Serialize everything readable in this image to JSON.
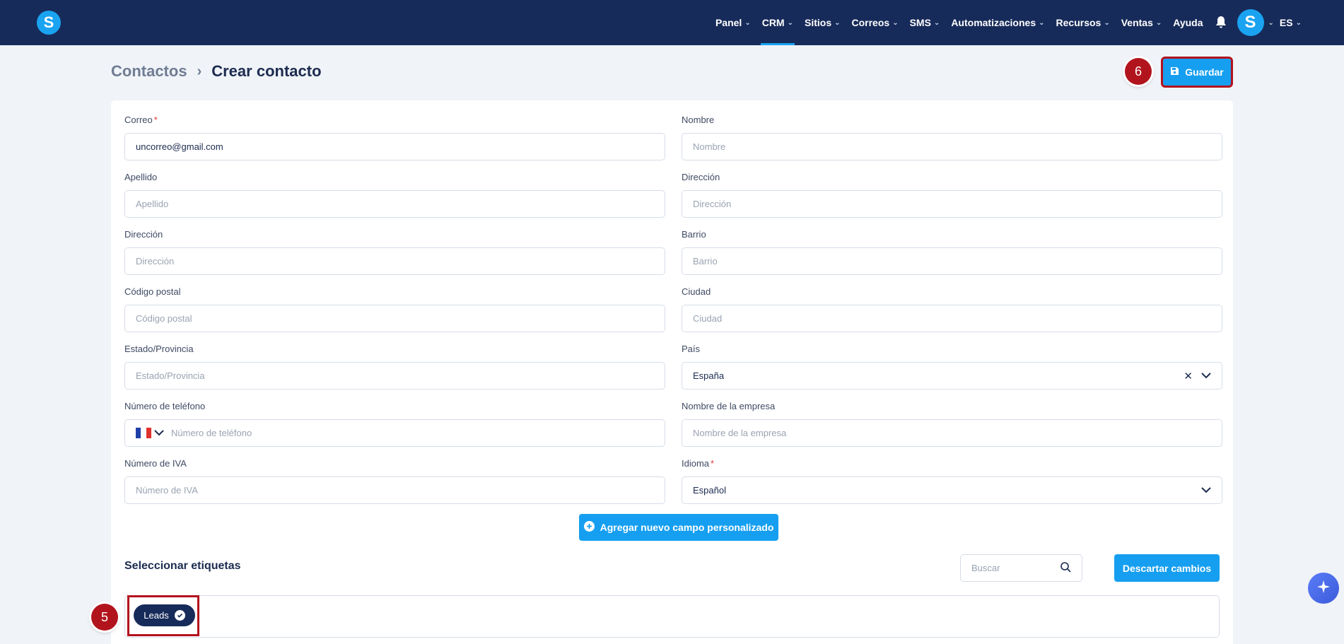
{
  "nav": {
    "items": [
      {
        "label": "Panel",
        "chevron": true,
        "active": false
      },
      {
        "label": "CRM",
        "chevron": true,
        "active": true
      },
      {
        "label": "Sitios",
        "chevron": true,
        "active": false
      },
      {
        "label": "Correos",
        "chevron": true,
        "active": false
      },
      {
        "label": "SMS",
        "chevron": true,
        "active": false
      },
      {
        "label": "Automatizaciones",
        "chevron": true,
        "active": false
      },
      {
        "label": "Recursos",
        "chevron": true,
        "active": false
      },
      {
        "label": "Ventas",
        "chevron": true,
        "active": false
      },
      {
        "label": "Ayuda",
        "chevron": false,
        "active": false
      }
    ],
    "logo_letter": "S",
    "avatar_letter": "S",
    "language": "ES",
    "icons": {
      "notifications": "bell-icon",
      "logo": "logo-icon"
    }
  },
  "breadcrumb": {
    "parent": "Contactos",
    "current": "Crear contacto"
  },
  "save_button": {
    "label": "Guardar",
    "icon": "floppy-disk-icon"
  },
  "badges": {
    "save": "6",
    "tag": "5"
  },
  "form": {
    "left": [
      {
        "label": "Correo",
        "required": true,
        "value": "uncorreo@gmail.com",
        "placeholder": ""
      },
      {
        "label": "Apellido",
        "required": false,
        "value": "",
        "placeholder": "Apellido"
      },
      {
        "label": "Dirección",
        "required": false,
        "value": "",
        "placeholder": "Dirección"
      },
      {
        "label": "Código postal",
        "required": false,
        "value": "",
        "placeholder": "Código postal"
      },
      {
        "label": "Estado/Provincia",
        "required": false,
        "value": "",
        "placeholder": "Estado/Provincia"
      },
      {
        "label": "Número de teléfono",
        "required": false,
        "value": "",
        "placeholder": "Número de teléfono",
        "phone": true
      },
      {
        "label": "Número de IVA",
        "required": false,
        "value": "",
        "placeholder": "Número de IVA"
      }
    ],
    "right": [
      {
        "label": "Nombre",
        "required": false,
        "value": "",
        "placeholder": "Nombre"
      },
      {
        "label": "Dirección",
        "required": false,
        "value": "",
        "placeholder": "Dirección"
      },
      {
        "label": "Barrio",
        "required": false,
        "value": "",
        "placeholder": "Barrio"
      },
      {
        "label": "Ciudad",
        "required": false,
        "value": "",
        "placeholder": "Ciudad"
      },
      {
        "label": "País",
        "required": false,
        "value": "España",
        "placeholder": "",
        "select": true,
        "clearable": true
      },
      {
        "label": "Nombre de la empresa",
        "required": false,
        "value": "",
        "placeholder": "Nombre de la empresa"
      },
      {
        "label": "Idioma",
        "required": true,
        "value": "Español",
        "placeholder": "",
        "select": true,
        "clearable": false
      }
    ],
    "phone_flag_colors": [
      "#1f3fa8",
      "#ffffff",
      "#e0312c"
    ]
  },
  "add_field_button": {
    "label": "Agregar nuevo campo personalizado"
  },
  "tags": {
    "title": "Seleccionar etiquetas",
    "search_placeholder": "Buscar",
    "discard_label": "Descartar cambios",
    "items": [
      {
        "label": "Leads",
        "selected": true
      }
    ]
  },
  "colors": {
    "nav_bg": "#172b5a",
    "accent": "#169ff0",
    "highlight": "#b3121e",
    "badge": "#b2141d"
  }
}
